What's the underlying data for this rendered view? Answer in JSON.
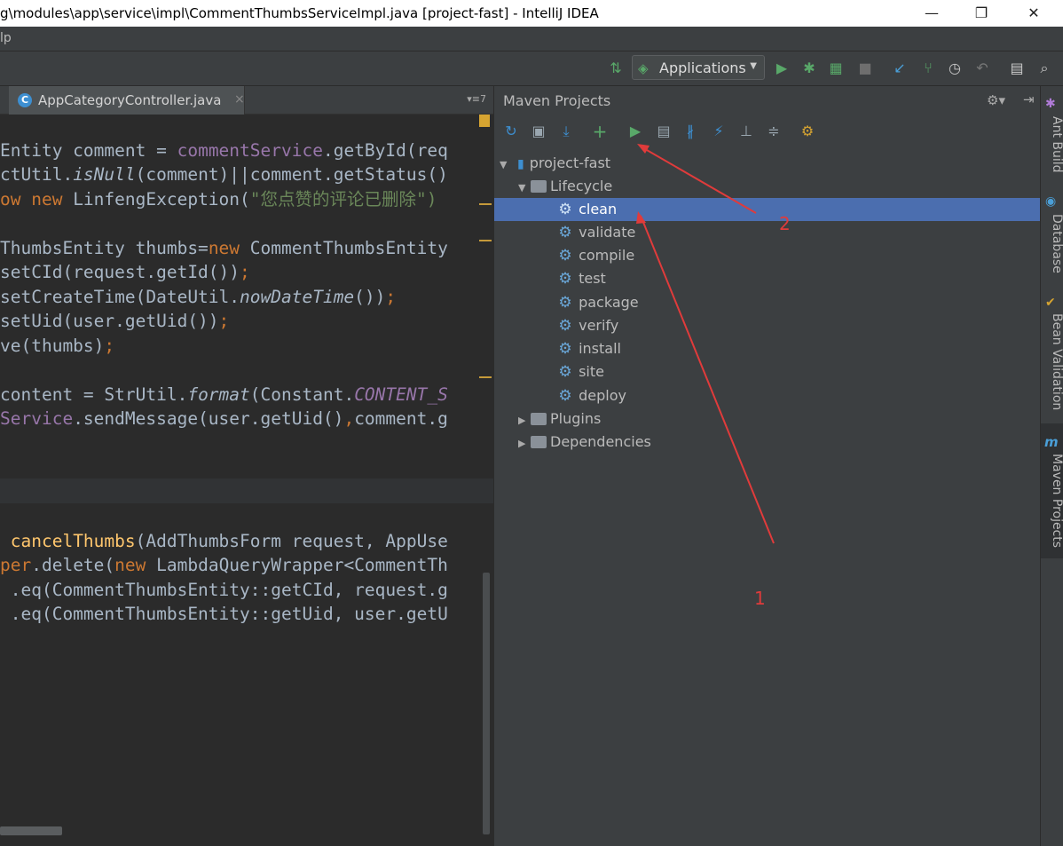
{
  "window": {
    "title": "g\\modules\\app\\service\\impl\\CommentThumbsServiceImpl.java [project-fast] - IntelliJ IDEA",
    "minimize_glyph": "—",
    "maximize_glyph": "❐",
    "close_glyph": "✕"
  },
  "menu": {
    "partial_item": "lp"
  },
  "toolbar": {
    "run_config_label": "Applications",
    "icons": [
      "build-icon",
      "run-icon",
      "debug-icon",
      "coverage-icon",
      "stop-icon",
      "vcs-update-icon",
      "vcs-commit-icon",
      "history-icon",
      "revert-icon",
      "project-structure-icon",
      "search-icon"
    ]
  },
  "editor": {
    "tab_name": "AppCategoryController.java",
    "tab_close": "×",
    "tab_menu": "▾≡7",
    "lines": {
      "l1": {
        "a": "Entity comment = ",
        "b": "commentService",
        "c": ".getById(req"
      },
      "l2": {
        "a": "ctUtil.",
        "b": "isNull",
        "c": "(comment)||comment.getStatus()"
      },
      "l3": {
        "a": "ow new ",
        "b": "LinfengException(",
        "c": "\"您点赞的评论已删除\")"
      },
      "l4": {
        "a": "ThumbsEntity thumbs=",
        "b": "new ",
        "c": "CommentThumbsEntity"
      },
      "l5": {
        "a": "setCId(request.getId())",
        "b": ";"
      },
      "l6": {
        "a": "setCreateTime(DateUtil.",
        "b": "nowDateTime",
        "c": "())",
        "d": ";"
      },
      "l7": {
        "a": "setUid(user.getUid())",
        "b": ";"
      },
      "l8": {
        "a": "ve(thumbs)",
        "b": ";"
      },
      "l9": {
        "a": "content = StrUtil.",
        "b": "format",
        "c": "(Constant.",
        "d": "CONTENT_S"
      },
      "l10": {
        "a": "Service",
        "b": ".sendMessage(user.getUid()",
        "c": ",",
        "d": "comment.g"
      },
      "l11": {
        "a": " ",
        "b": "cancelThumbs",
        "c": "(AddThumbsForm request, AppUse"
      },
      "l12": {
        "a": "per",
        "b": ".delete(",
        "c": "new ",
        "d": "LambdaQueryWrapper<CommentTh"
      },
      "l13": {
        "a": " .eq(CommentThumbsEntity::getCId, request.g"
      },
      "l14": {
        "a": " .eq(CommentThumbsEntity::getUid, user.getU"
      }
    }
  },
  "maven": {
    "title": "Maven Projects",
    "settings_glyph": "⚙▾",
    "hide_glyph": "⇥",
    "tools": [
      "refresh-icon",
      "generate-sources-icon",
      "download-icon",
      "add-icon",
      "run-goal-icon",
      "execute-icon",
      "toggle-offline-icon",
      "skip-tests-icon",
      "dependencies-icon",
      "collapse-all-icon",
      "settings-icon"
    ],
    "project": "project-fast",
    "lifecycle_label": "Lifecycle",
    "lifecycle": [
      "clean",
      "validate",
      "compile",
      "test",
      "package",
      "verify",
      "install",
      "site",
      "deploy"
    ],
    "plugins_label": "Plugins",
    "dependencies_label": "Dependencies"
  },
  "side_tabs": [
    "Ant Build",
    "Database",
    "Bean Validation",
    "Maven Projects"
  ],
  "annotations": {
    "one": "1",
    "two": "2"
  },
  "colors": {
    "selection": "#4b6eaf",
    "annotation": "#e03b3b",
    "run_green": "#59a869"
  }
}
